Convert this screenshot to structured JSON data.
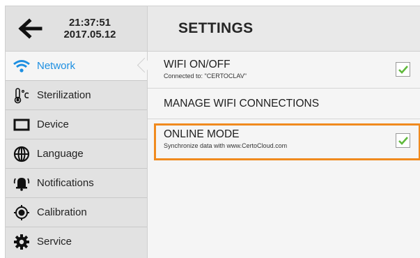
{
  "header": {
    "time": "21:37:51",
    "date": "2017.05.12",
    "title": "SETTINGS"
  },
  "sidebar": {
    "items": [
      {
        "label": "Network",
        "icon": "wifi-icon",
        "active": true
      },
      {
        "label": "Sterilization",
        "icon": "thermometer-celsius-icon",
        "active": false
      },
      {
        "label": "Device",
        "icon": "device-screen-icon",
        "active": false
      },
      {
        "label": "Language",
        "icon": "globe-icon",
        "active": false
      },
      {
        "label": "Notifications",
        "icon": "bell-ringing-icon",
        "active": false
      },
      {
        "label": "Calibration",
        "icon": "target-icon",
        "active": false
      },
      {
        "label": "Service",
        "icon": "gear-icon",
        "active": false
      }
    ]
  },
  "settings": {
    "wifi": {
      "title": "WIFI ON/OFF",
      "subtitle": "Connected to: \"CERTOCLAV\"",
      "checked": true
    },
    "manage": {
      "title": "MANAGE WIFI CONNECTIONS"
    },
    "online": {
      "title": "ONLINE MODE",
      "subtitle": "Synchronize data with www.CertoCloud.com",
      "checked": true
    }
  },
  "colors": {
    "accent": "#1d8fe1",
    "highlight": "#f08a1e",
    "check": "#5fb93b"
  }
}
